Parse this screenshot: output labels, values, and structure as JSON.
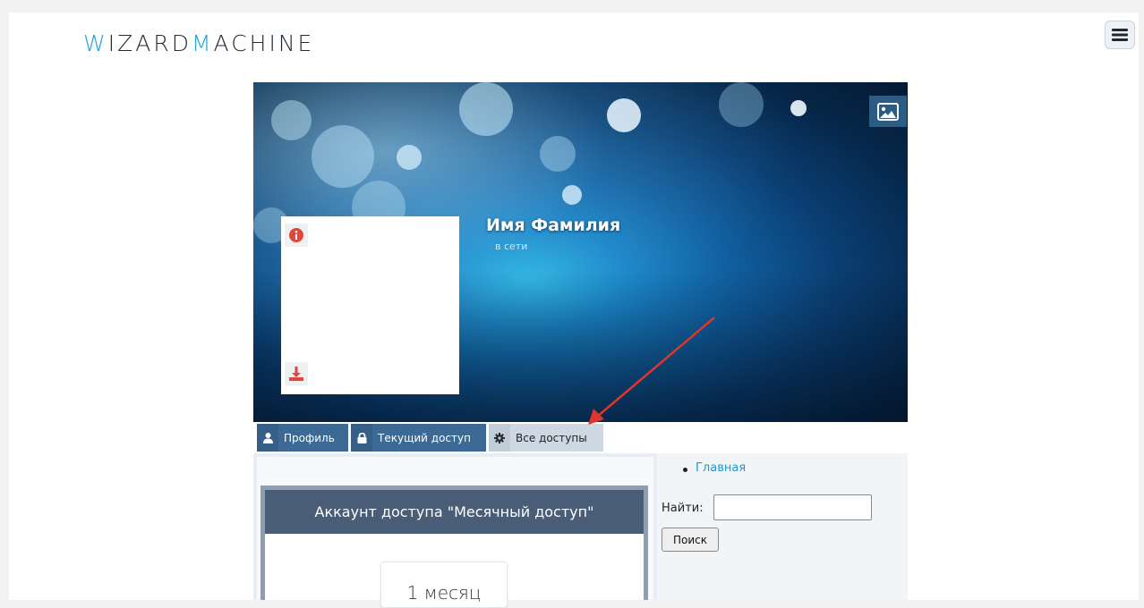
{
  "brand": {
    "logo_prefix_accent": "W",
    "logo_part1": "IZARD",
    "logo_accent2": "M",
    "logo_part2": "ACHINE"
  },
  "header": {
    "menu_icon": "hamburger-icon"
  },
  "profile": {
    "name": "Имя Фамилия",
    "status": "в сети",
    "cover_change_icon": "image-icon",
    "avatar_info_icon": "info-circle-icon",
    "avatar_download_icon": "download-icon"
  },
  "tabs": [
    {
      "label": "Профиль",
      "icon": "user-icon",
      "active": true
    },
    {
      "label": "Текущий доступ",
      "icon": "lock-icon",
      "active": true
    },
    {
      "label": "Все доступы",
      "icon": "gear-icon",
      "active": false
    }
  ],
  "access_card": {
    "title": "Аккаунт доступа \"Месячный доступ\"",
    "plan_label": "1 месяц"
  },
  "sidebar": {
    "nav_items": [
      {
        "label": "Главная"
      }
    ],
    "search_label": "Найти:",
    "search_value": "",
    "search_button": "Поиск"
  },
  "colors": {
    "accent": "#1ea4d6",
    "tab_active": "#3d6a94",
    "tab_inactive": "#cdd8e2",
    "card_header": "#4a5d76",
    "annotation_arrow": "#e0352b"
  }
}
